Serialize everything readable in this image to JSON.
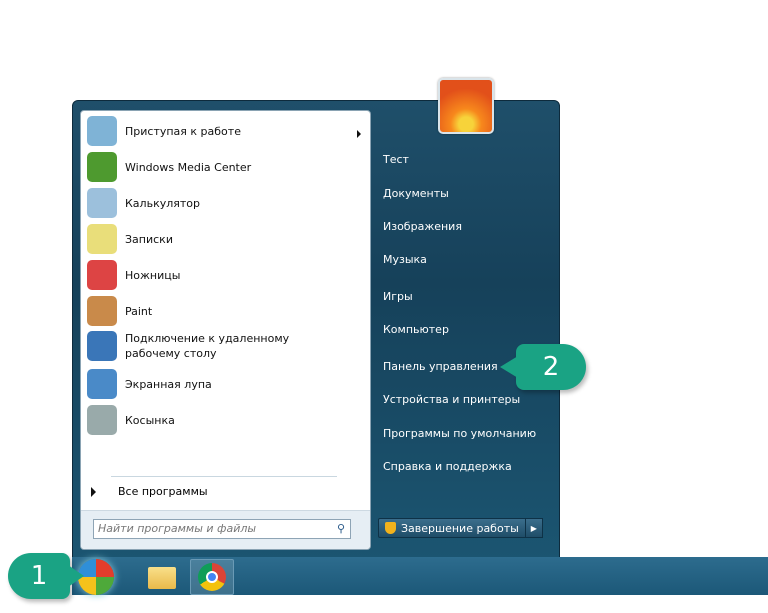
{
  "start_menu": {
    "programs": [
      {
        "label": "Приступая к работе",
        "icon": "getting-started-icon",
        "color": "#7fb3d6",
        "has_submenu": true
      },
      {
        "label": "Windows Media Center",
        "icon": "media-center-icon",
        "color": "#4e9a2f"
      },
      {
        "label": "Калькулятор",
        "icon": "calculator-icon",
        "color": "#9cc0dc"
      },
      {
        "label": "Записки",
        "icon": "sticky-notes-icon",
        "color": "#e9de7a"
      },
      {
        "label": "Ножницы",
        "icon": "snipping-tool-icon",
        "color": "#d44"
      },
      {
        "label": "Paint",
        "icon": "paint-icon",
        "color": "#c98a4a"
      },
      {
        "label": "Подключение к удаленному рабочему столу",
        "icon": "remote-desktop-icon",
        "color": "#3a76b8"
      },
      {
        "label": "Экранная лупа",
        "icon": "magnifier-icon",
        "color": "#4a8ac8"
      },
      {
        "label": "Косынка",
        "icon": "solitaire-icon",
        "color": "#9aa"
      }
    ],
    "all_programs": "Все программы",
    "search_placeholder": "Найти программы и файлы",
    "right_links": [
      "Тест",
      "Документы",
      "Изображения",
      "Музыка",
      "Игры",
      "Компьютер",
      "Панель управления",
      "Устройства и принтеры",
      "Программы по умолчанию",
      "Справка и поддержка"
    ],
    "shutdown_label": "Завершение работы"
  },
  "badges": {
    "step1": "1",
    "step2": "2",
    "color": "#1aa384"
  }
}
